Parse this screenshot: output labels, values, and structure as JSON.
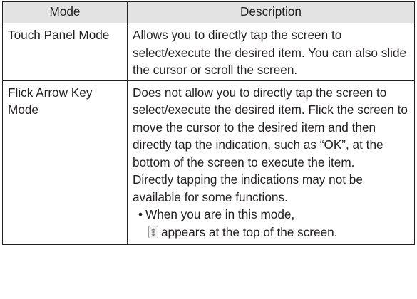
{
  "table": {
    "headers": {
      "mode": "Mode",
      "description": "Description"
    },
    "rows": [
      {
        "mode": "Touch Panel Mode",
        "description": "Allows you to directly tap the screen to select/execute the desired item. You can also slide the cursor or scroll the screen."
      },
      {
        "mode": "Flick Arrow Key Mode",
        "description": "Does not allow you to directly tap the screen to select/execute the desired item. Flick the screen to move the cursor to the desired item and then directly tap the indication, such as “OK”, at the bottom of the screen to execute the item.",
        "note": "Directly tapping the indications may not be available for some functions.",
        "bullet_marker": "•",
        "bullet": "When you are in this mode,",
        "bullet_continuation": "appears at the top of the screen.",
        "status_icon": "flick-arrow-mode-icon"
      }
    ]
  }
}
